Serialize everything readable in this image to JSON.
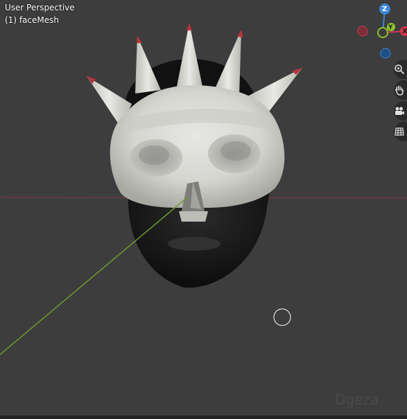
{
  "viewport": {
    "view_name": "User Perspective",
    "object_name": "(1) faceMesh",
    "background": "#3d3d3d"
  },
  "gizmo": {
    "z_label": "Z",
    "y_label": "Y",
    "x_label": "X",
    "colors": {
      "x": "#d9364e",
      "y": "#8bc530",
      "z": "#3d86d6"
    }
  },
  "nav_buttons": [
    {
      "name": "zoom-icon"
    },
    {
      "name": "hand-icon"
    },
    {
      "name": "camera-icon"
    },
    {
      "name": "grid-icon"
    }
  ],
  "watermark": "Dgeza"
}
